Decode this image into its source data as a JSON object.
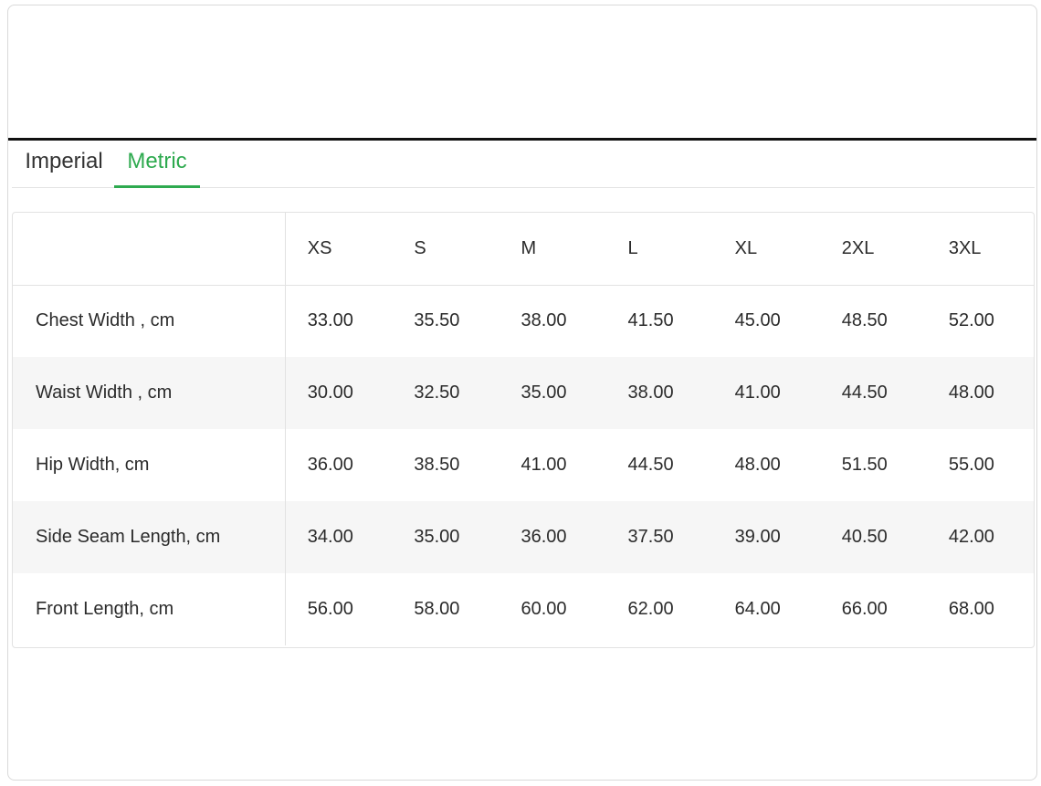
{
  "tabs": [
    {
      "label": "Imperial",
      "active": false
    },
    {
      "label": "Metric",
      "active": true
    }
  ],
  "colors": {
    "accent": "#2eaa4f"
  },
  "table": {
    "headers": [
      "XS",
      "S",
      "M",
      "L",
      "XL",
      "2XL",
      "3XL"
    ],
    "rows": [
      {
        "label": "Chest Width , cm",
        "values": [
          "33.00",
          "35.50",
          "38.00",
          "41.50",
          "45.00",
          "48.50",
          "52.00"
        ]
      },
      {
        "label": "Waist Width , cm",
        "values": [
          "30.00",
          "32.50",
          "35.00",
          "38.00",
          "41.00",
          "44.50",
          "48.00"
        ]
      },
      {
        "label": "Hip Width, cm",
        "values": [
          "36.00",
          "38.50",
          "41.00",
          "44.50",
          "48.00",
          "51.50",
          "55.00"
        ]
      },
      {
        "label": "Side Seam Length, cm",
        "values": [
          "34.00",
          "35.00",
          "36.00",
          "37.50",
          "39.00",
          "40.50",
          "42.00"
        ]
      },
      {
        "label": "Front Length, cm",
        "values": [
          "56.00",
          "58.00",
          "60.00",
          "62.00",
          "64.00",
          "66.00",
          "68.00"
        ]
      }
    ]
  }
}
